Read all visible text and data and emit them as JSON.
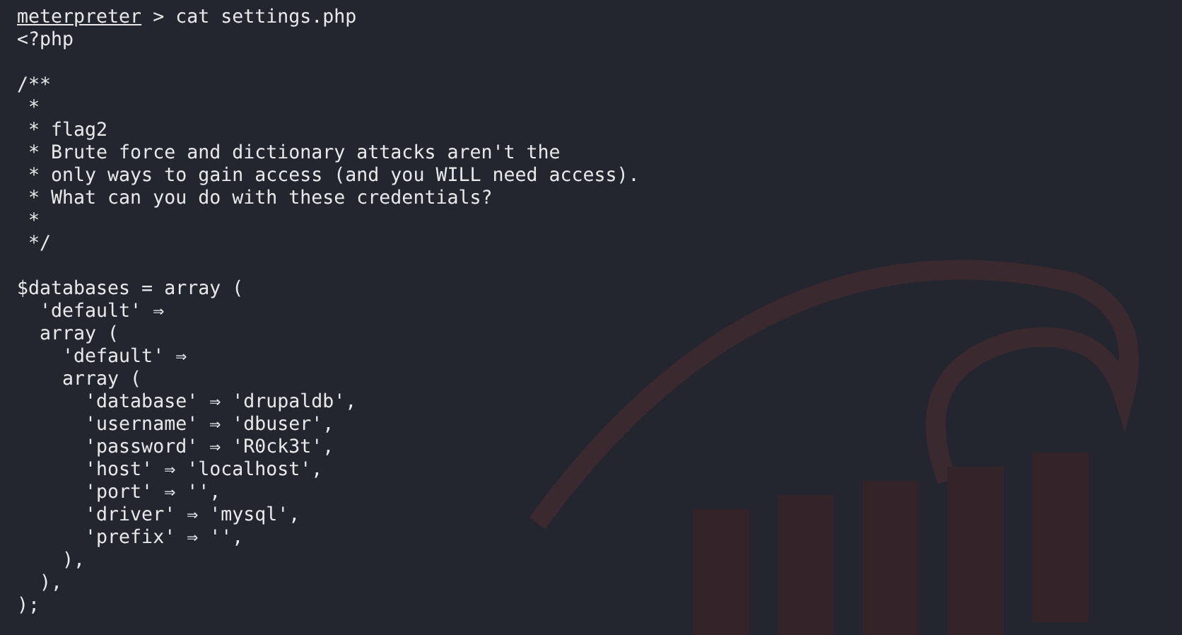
{
  "prompt": {
    "label": "meterpreter",
    "command": "> cat settings.php"
  },
  "output_blocks": [
    [
      "<?php"
    ],
    [
      "/**",
      " *",
      " * flag2",
      " * Brute force and dictionary attacks aren't the",
      " * only ways to gain access (and you WILL need access).",
      " * What can you do with these credentials?",
      " *",
      " */"
    ],
    [
      "$databases = array (",
      "  'default' ⇒",
      "  array (",
      "    'default' ⇒",
      "    array (",
      "      'database' ⇒ 'drupaldb',",
      "      'username' ⇒ 'dbuser',",
      "      'password' ⇒ 'R0ck3t',",
      "      'host' ⇒ 'localhost',",
      "      'port' ⇒ '',",
      "      'driver' ⇒ 'mysql',",
      "      'prefix' ⇒ '',",
      "    ),",
      "  ),",
      ");"
    ]
  ]
}
